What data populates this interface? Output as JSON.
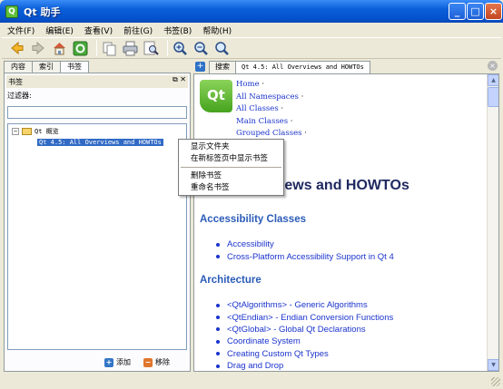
{
  "window": {
    "title": "Qt 助手",
    "app_icon_glyph": "Q"
  },
  "menubar": [
    {
      "label": "文件(F)"
    },
    {
      "label": "编辑(E)"
    },
    {
      "label": "查看(V)"
    },
    {
      "label": "前往(G)"
    },
    {
      "label": "书签(B)"
    },
    {
      "label": "帮助(H)"
    }
  ],
  "toolbar": {
    "icons": [
      "back-arrow-icon",
      "forward-arrow-icon",
      "home-icon",
      "sync-contents-icon",
      "copy-icon",
      "print-icon",
      "find-icon",
      "zoom-in-icon",
      "zoom-out-icon",
      "zoom-normal-icon"
    ]
  },
  "left_tabs": [
    {
      "label": "内容"
    },
    {
      "label": "索引"
    },
    {
      "label": "书签",
      "active": true
    }
  ],
  "bookmarks_dock": {
    "title": "书签",
    "filter_label": "过滤器:",
    "filter_value": "",
    "tree": [
      {
        "label": "Qt 概览",
        "expander": "⊟",
        "level": 0
      },
      {
        "label": "Qt 4.5: All Overviews and HOWTOs",
        "level": 1,
        "selected": true
      }
    ],
    "add_label": "添加",
    "remove_label": "移除"
  },
  "right_tabs": [
    {
      "label": "搜索"
    },
    {
      "label": "Qt 4.5: All Overviews and HOWTOs",
      "active": true
    }
  ],
  "context_menu": {
    "items": [
      "显示文件夹",
      "在新标签页中显示书签"
    ],
    "items2": [
      "删除书签",
      "重命名书签"
    ]
  },
  "doc": {
    "logo_text": "Qt",
    "navlinks": [
      "Home",
      "All Namespaces",
      "All Classes",
      "Main Classes",
      "Grouped Classes"
    ],
    "navlink_separator": "·",
    "heading_visible": "views and HOWTOs",
    "sections": [
      {
        "title": "Accessibility Classes",
        "items": [
          "Accessibility",
          "Cross-Platform Accessibility Support in Qt 4"
        ]
      },
      {
        "title": "Architecture",
        "items": [
          "<QtAlgorithms> - Generic Algorithms",
          "<QtEndian> - Endian Conversion Functions",
          "<QtGlobal> - Global Qt Declarations",
          "Coordinate System",
          "Creating Custom Qt Types",
          "Drag and Drop"
        ]
      }
    ]
  },
  "colors": {
    "accent": "#0a5fd8",
    "link": "#1a33cc",
    "section": "#2a5bb8",
    "selection": "#316ac5"
  }
}
